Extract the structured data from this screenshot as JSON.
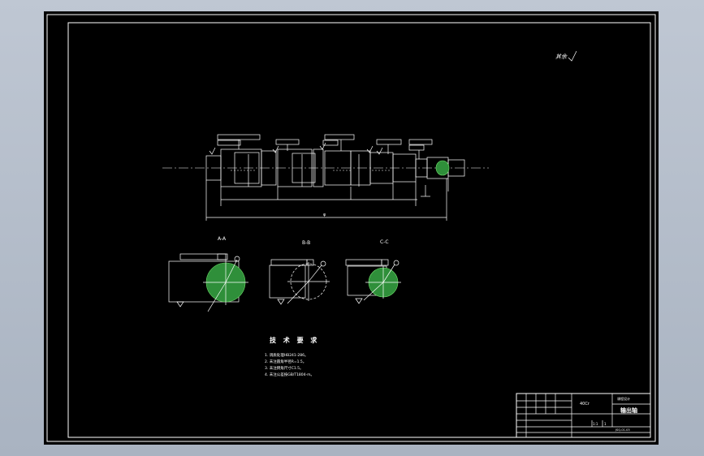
{
  "drawing": {
    "roughness_note": "其余",
    "sections": {
      "a": "A-A",
      "b": "B-B",
      "c": "C-C"
    },
    "overall_dim": "φ",
    "tech_title": "技 术 要 求",
    "tech_notes": [
      "1. 调质处理HB241-286。",
      "2. 未注圆角半径R=1.5。",
      "3. 未注倒角尺寸C1.5。",
      "4. 未注公差按GB/T1804-m。"
    ],
    "title_block": {
      "part_name": "输出轴",
      "material": "40Cr",
      "school": "课程设计",
      "scale": "1:1",
      "drawing_no": "JSQ-01-03",
      "count": "1"
    }
  }
}
